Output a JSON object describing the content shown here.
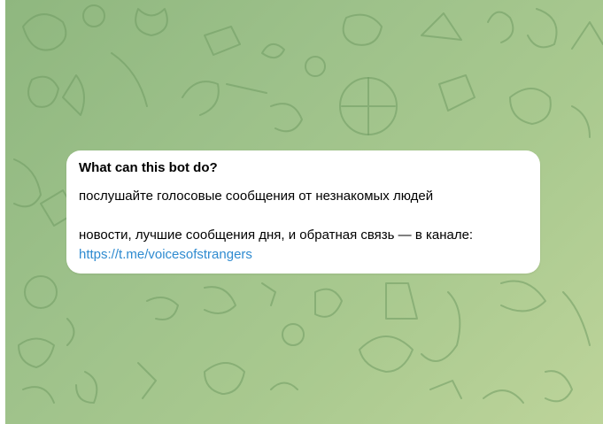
{
  "bot_info": {
    "title": "What can this bot do?",
    "description_line1": "послушайте голосовые сообщения от незнакомых людей",
    "description_line2": "новости, лучшие сообщения дня, и обратная связь — в канале:",
    "channel_link": "https://t.me/voicesofstrangers"
  },
  "colors": {
    "background_start": "#8fb77f",
    "background_end": "#bdd49a",
    "card_background": "#ffffff",
    "link": "#2f8bd0"
  }
}
